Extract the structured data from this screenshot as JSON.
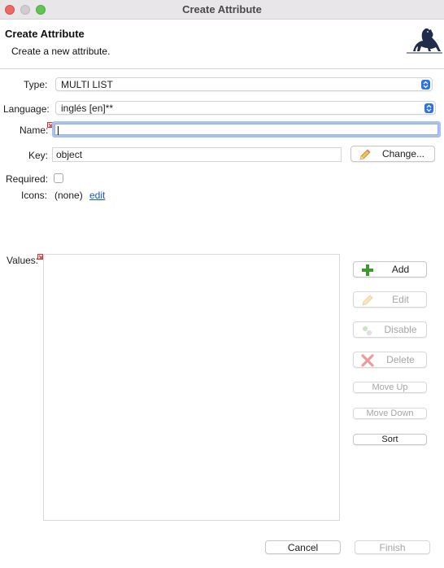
{
  "window": {
    "title": "Create Attribute"
  },
  "header": {
    "title": "Create Attribute",
    "description": "Create a new attribute."
  },
  "form": {
    "type": {
      "label": "Type:",
      "value": "MULTI LIST"
    },
    "language": {
      "label": "Language:",
      "value": "inglés [en]**"
    },
    "name": {
      "label": "Name:",
      "value": ""
    },
    "key": {
      "label": "Key:",
      "value": "object",
      "change_button": "Change..."
    },
    "required": {
      "label": "Required:",
      "checked": false
    },
    "icons": {
      "label": "Icons:",
      "value": "(none)",
      "edit_link": "edit"
    },
    "values": {
      "label": "Values:",
      "items": []
    }
  },
  "value_buttons": {
    "add": "Add",
    "edit": "Edit",
    "disable": "Disable",
    "delete": "Delete",
    "move_up": "Move Up",
    "move_down": "Move Down",
    "sort": "Sort"
  },
  "footer": {
    "cancel": "Cancel",
    "finish": "Finish"
  },
  "colors": {
    "accent": "#2c73e3",
    "focus_ring": "#a8c1ef",
    "link": "#1a56c6",
    "error_marker": "#c93a3a",
    "add_icon": "#3d9a2e",
    "delete_icon": "#d94a4a"
  }
}
